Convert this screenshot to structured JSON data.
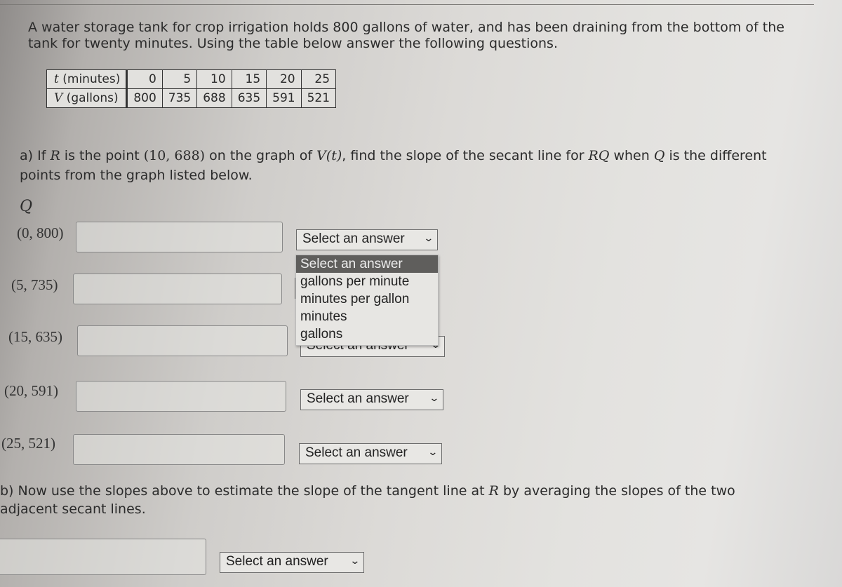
{
  "intro": "A water storage tank for crop irrigation holds 800 gallons of water, and has been draining from the bottom of the tank for twenty minutes. Using the table below answer the following questions.",
  "table": {
    "row_t": {
      "var": "t",
      "unit": " (minutes)",
      "values": [
        "0",
        "5",
        "10",
        "15",
        "20",
        "25"
      ]
    },
    "row_v": {
      "var": "V",
      "unit": " (gallons)",
      "values": [
        "800",
        "735",
        "688",
        "635",
        "591",
        "521"
      ]
    }
  },
  "part_a": {
    "prefix": "a) If ",
    "R": "R",
    "mid1": " is the point ",
    "point": "(10, 688)",
    "mid2": " on the graph of ",
    "func": "V(t)",
    "mid3": ", find the slope of the secant line for ",
    "RQ": "RQ",
    "mid4": " when ",
    "Q": "Q",
    "suffix": " is the different points from the graph listed below.",
    "q_label": "Q"
  },
  "rows": [
    {
      "point": "(0, 800)",
      "input_value": "",
      "select_value": "Select an answer"
    },
    {
      "point": "(5, 735)",
      "input_value": "",
      "select_value": "Select an answer"
    },
    {
      "point": "(15, 635)",
      "input_value": "",
      "select_value": "Select an answer"
    },
    {
      "point": "(20, 591)",
      "input_value": "",
      "select_value": "Select an answer"
    },
    {
      "point": "(25, 521)",
      "input_value": "",
      "select_value": "Select an answer"
    }
  ],
  "dropdown_open": {
    "options": [
      "Select an answer",
      "gallons per minute",
      "minutes per gallon",
      "minutes",
      "gallons"
    ],
    "highlighted": "Select an answer"
  },
  "part_b": {
    "prefix": "b) Now use the slopes above to estimate the slope of the tangent line at ",
    "R": "R",
    "suffix": " by averaging the slopes of the two adjacent secant lines.",
    "input_value": "",
    "select_value": "Select an answer"
  },
  "icons": {
    "chevron": "⌄"
  }
}
